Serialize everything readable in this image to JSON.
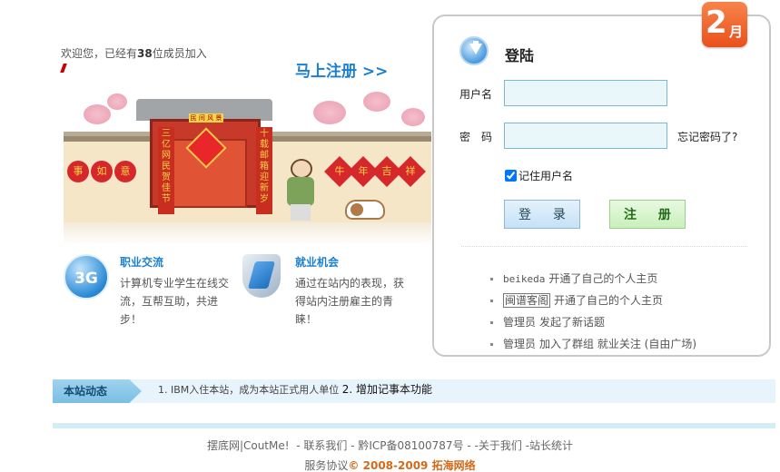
{
  "welcome": {
    "prefix": "欢迎您，已经有",
    "count": "38",
    "suffix": "位成员加入"
  },
  "register_now": "马上注册 >>",
  "banner": {
    "gate_plaque": "民 间 风 景",
    "couplet_left": "三亿网民贺佳节",
    "couplet_right": "十载邮箱迎新岁",
    "lanterns_left": [
      "事",
      "如",
      "意"
    ],
    "diamonds_right": [
      "牛",
      "年",
      "吉",
      "祥"
    ]
  },
  "features": [
    {
      "icon": "3g-icon",
      "icon_text": "3G",
      "title": "职业交流",
      "desc": "计算机专业学生在线交流，互帮互助，共进步！"
    },
    {
      "icon": "shield-icon",
      "title": "就业机会",
      "desc": "通过在站内的表现，获得站内注册雇主的青睐！"
    }
  ],
  "login": {
    "title": "登陆",
    "username_label": "用户名",
    "password_label": "密　码",
    "forgot": "忘记密码了?",
    "remember": "记住用户名",
    "remember_checked": true,
    "login_button": "登 录",
    "register_button": "注 册"
  },
  "month_badge": {
    "num": "2",
    "unit": "月"
  },
  "activity": [
    {
      "user": "beikeda",
      "action": "开通了自己的个人主页"
    },
    {
      "user": "闽谱客阁",
      "action": "开通了自己的个人主页"
    },
    {
      "user": "管理员",
      "action": "发起了新话题"
    },
    {
      "user": "管理员",
      "action": "加入了群组 就业关注 (自由广场)"
    }
  ],
  "news": {
    "tag": "本站动态",
    "item1": "1. IBM入住本站，成为本站正式用人单位",
    "item2": "2. 增加记事本功能"
  },
  "footer": {
    "links": [
      "摆底网|CoutMe!",
      "- 联系我们",
      "- 黔ICP备08100787号",
      "- -关于我们",
      "-站长统计"
    ],
    "agreement": "服务协议",
    "copyright": "© 2008-2009 拓海网络"
  }
}
